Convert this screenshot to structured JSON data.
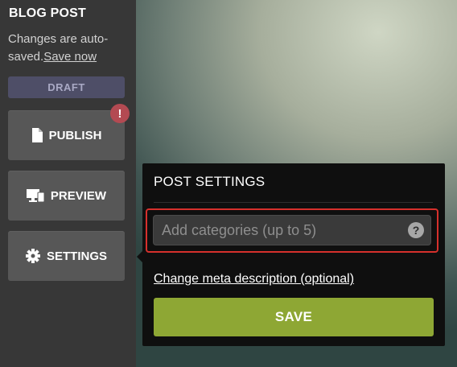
{
  "sidebar": {
    "title": "BLOG POST",
    "autosave_text": "Changes are auto-saved.",
    "save_now_label": "Save now",
    "status_badge": "DRAFT",
    "publish_label": "PUBLISH",
    "publish_alert": "!",
    "preview_label": "PREVIEW",
    "settings_label": "SETTINGS",
    "icons": {
      "publish": "document-icon",
      "preview": "monitor-icon",
      "settings": "gear-icon"
    }
  },
  "popover": {
    "title": "POST SETTINGS",
    "categories_placeholder": "Add categories (up to 5)",
    "help_label": "?",
    "meta_link": "Change meta description (optional)",
    "save_label": "SAVE"
  },
  "colors": {
    "sidebar_bg": "#373737",
    "button_bg": "#575757",
    "draft_bg": "#4e4e67",
    "alert": "#b34a52",
    "save_green": "#8ea734",
    "highlight": "#d6302c"
  }
}
